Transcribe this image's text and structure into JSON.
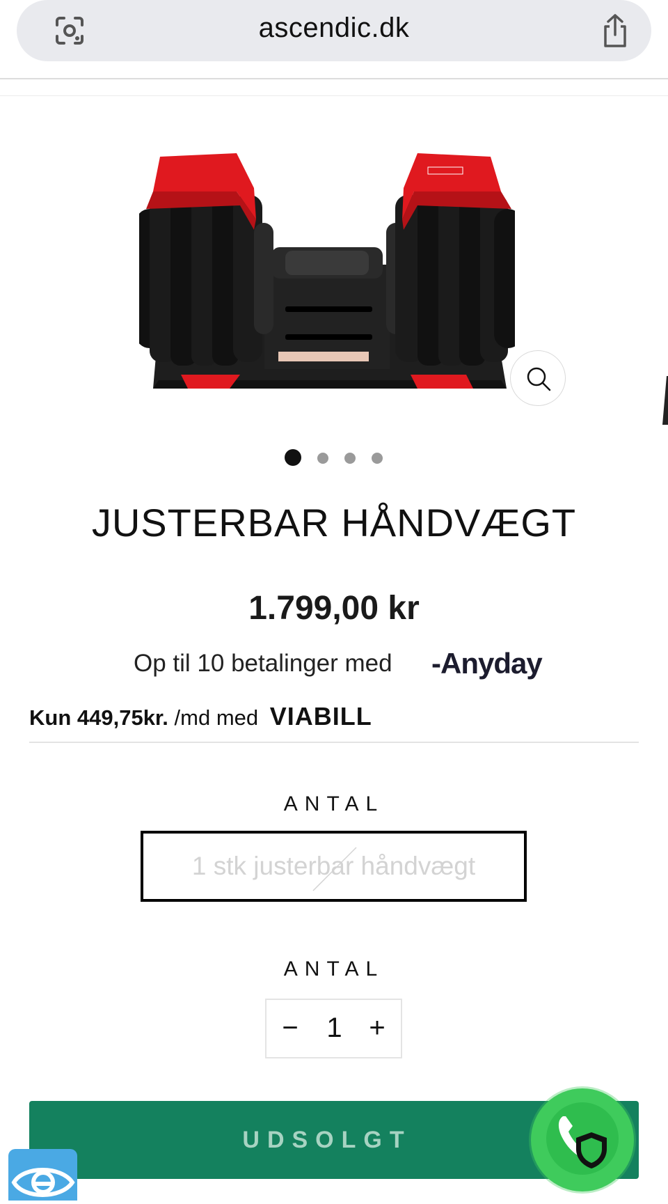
{
  "browser": {
    "url": "ascendic.dk",
    "lens_icon": "visual-search-icon",
    "share_icon": "share-icon"
  },
  "product": {
    "image_alt": "Justerbar håndvægt (adjustable dumbbell) on stand",
    "title": "JUSTERBAR HÅNDVÆGT",
    "price": "1.799,00 kr",
    "gallery": {
      "count": 4,
      "active_index": 0
    },
    "zoom_icon": "magnifier-icon"
  },
  "financing": {
    "anyday_text": "Op til 10 betalinger med",
    "anyday_brand": "-Anyday",
    "viabill_amount": "Kun 449,75kr.",
    "viabill_text": "/md med",
    "viabill_brand": "VIABILL"
  },
  "variant": {
    "label": "ANTAL",
    "option": "1 stk justerbar håndvægt",
    "available": false
  },
  "quantity": {
    "label": "ANTAL",
    "minus": "−",
    "value": "1",
    "plus": "+"
  },
  "cta": {
    "label": "UDSOLGT"
  },
  "widgets": {
    "phone_icon": "phone-icon",
    "shield_icon": "shield-icon",
    "accessibility_icon": "eye-icon"
  },
  "colors": {
    "accent_green": "#14815e",
    "cta_text": "#a7d3c2",
    "fab_green": "#3fcb5c",
    "accessibility_blue": "#4aa9e4"
  }
}
